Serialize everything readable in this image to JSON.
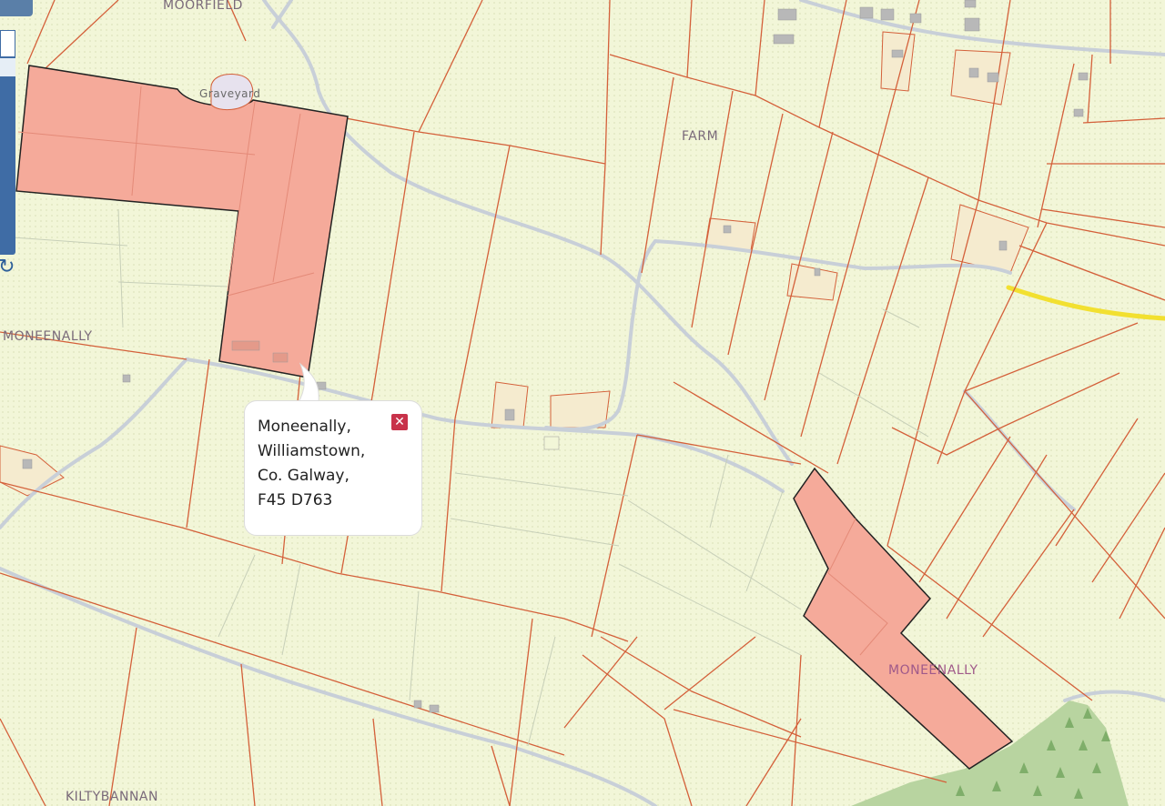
{
  "map": {
    "place_labels": {
      "moorfield": "MOORFIELD",
      "graveyard": "Graveyard",
      "farm": "FARM",
      "moneenally_west": "MONEENALLY",
      "moneenally_south": "MONEENALLY",
      "kiltybannan": "KILTYBANNAN"
    },
    "colors": {
      "background": "#f2f6d8",
      "boundary": "#d4603a",
      "parcel_fill": "#f5aa9a",
      "parcel_outline": "#222222",
      "road": "#c8cfd8",
      "regional_road": "#f2e030",
      "forest": "#b8d4a0"
    }
  },
  "popup": {
    "address_lines": [
      "Moneenally,",
      "Williamstown,",
      "Co. Galway,",
      "F45 D763"
    ],
    "close_icon": "close-icon"
  },
  "controls": {
    "refresh_icon": "↻",
    "zoom_icon": "zoom-slider"
  }
}
